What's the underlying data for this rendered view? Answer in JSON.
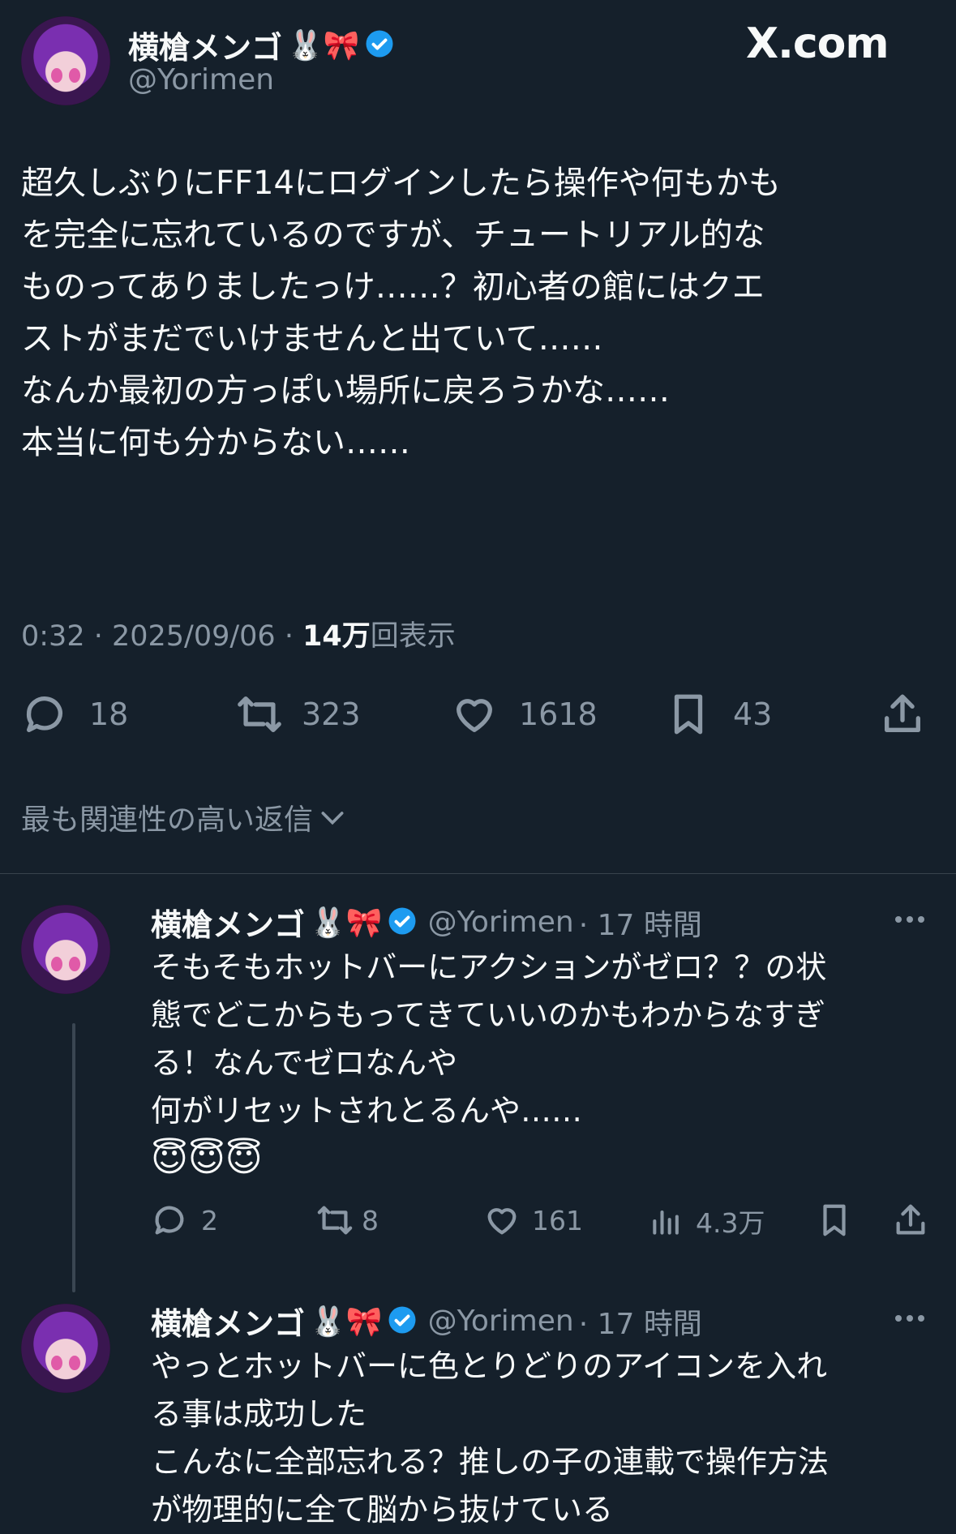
{
  "brand": {
    "logo_text": "X.com"
  },
  "main_tweet": {
    "display_name": "横槍メンゴ",
    "name_emoji": "🐰🎀",
    "handle": "@Yorimen",
    "text_lines": [
      "超久しぶりにFF14にログインしたら操作や何もかも",
      "を完全に忘れているのですが、チュートリアル的な",
      "ものってありましたっけ……？初心者の館にはクエ",
      "ストがまだでいけませんと出ていて……",
      "なんか最初の方っぽい場所に戻ろうかな……",
      "本当に何も分からない……"
    ],
    "time": "0:32 · 2025/09/06 · ",
    "views_count": "14万",
    "views_label": "回表示",
    "replies": "18",
    "retweets": "323",
    "likes": "1618",
    "bookmarks": "43"
  },
  "sort": {
    "label": "最も関連性の高い返信"
  },
  "replies": [
    {
      "display_name": "横槍メンゴ",
      "name_emoji": "🐰🎀",
      "handle": "@Yorimen",
      "age": "· 17 時間",
      "text_lines": [
        "そもそもホットバーにアクションがゼロ？？の状",
        "態でどこからもってきていいのかもわからなすぎ",
        "る！なんでゼロなんや",
        "何がリセットされとるんや……",
        "😇😇😇"
      ],
      "replies": "2",
      "retweets": "8",
      "likes": "161",
      "views": "4.3万"
    },
    {
      "display_name": "横槍メンゴ",
      "name_emoji": "🐰🎀",
      "handle": "@Yorimen",
      "age": "· 17 時間",
      "text_lines": [
        "やっとホットバーに色とりどりのアイコンを入れ",
        "る事は成功した",
        "こんなに全部忘れる？推しの子の連載で操作方法",
        "が物理的に全て脳から抜けている"
      ]
    }
  ],
  "colors": {
    "background": "#15202b",
    "text": "#f7f9f9",
    "muted": "#8b98a5",
    "verified": "#1d9bf0"
  }
}
